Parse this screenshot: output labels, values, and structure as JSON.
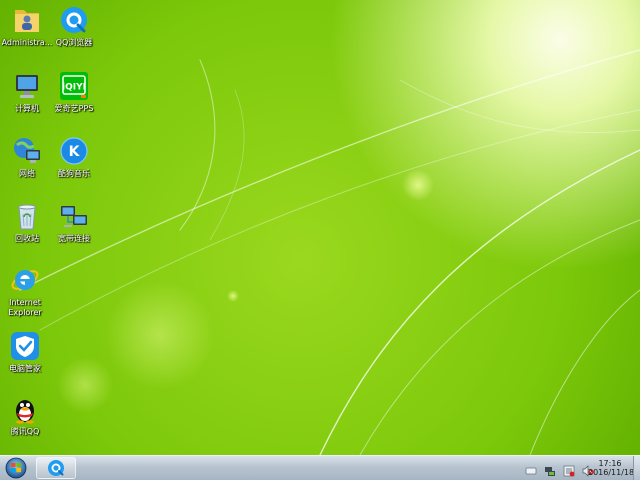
{
  "desktop_icons": [
    {
      "label": "Administra..."
    },
    {
      "label": "QQ浏览器"
    },
    {
      "label": "计算机"
    },
    {
      "label": "爱奇艺PPS"
    },
    {
      "label": "网络"
    },
    {
      "label": "酷狗音乐"
    },
    {
      "label": "回收站"
    },
    {
      "label": "宽带连接"
    },
    {
      "label": "Internet Explorer"
    },
    {
      "label": "电脑管家"
    },
    {
      "label": "腾讯QQ"
    }
  ],
  "clock": {
    "time": "17:16",
    "date": "2016/11/18"
  },
  "colors": {
    "wallpaper_base": "#7cc80a",
    "taskbar": "#b7c4d0"
  },
  "icons": {
    "start": "windows-start-orb",
    "tray": [
      "action-center-icon",
      "network-icon",
      "security-icon",
      "volume-muted-icon"
    ]
  }
}
